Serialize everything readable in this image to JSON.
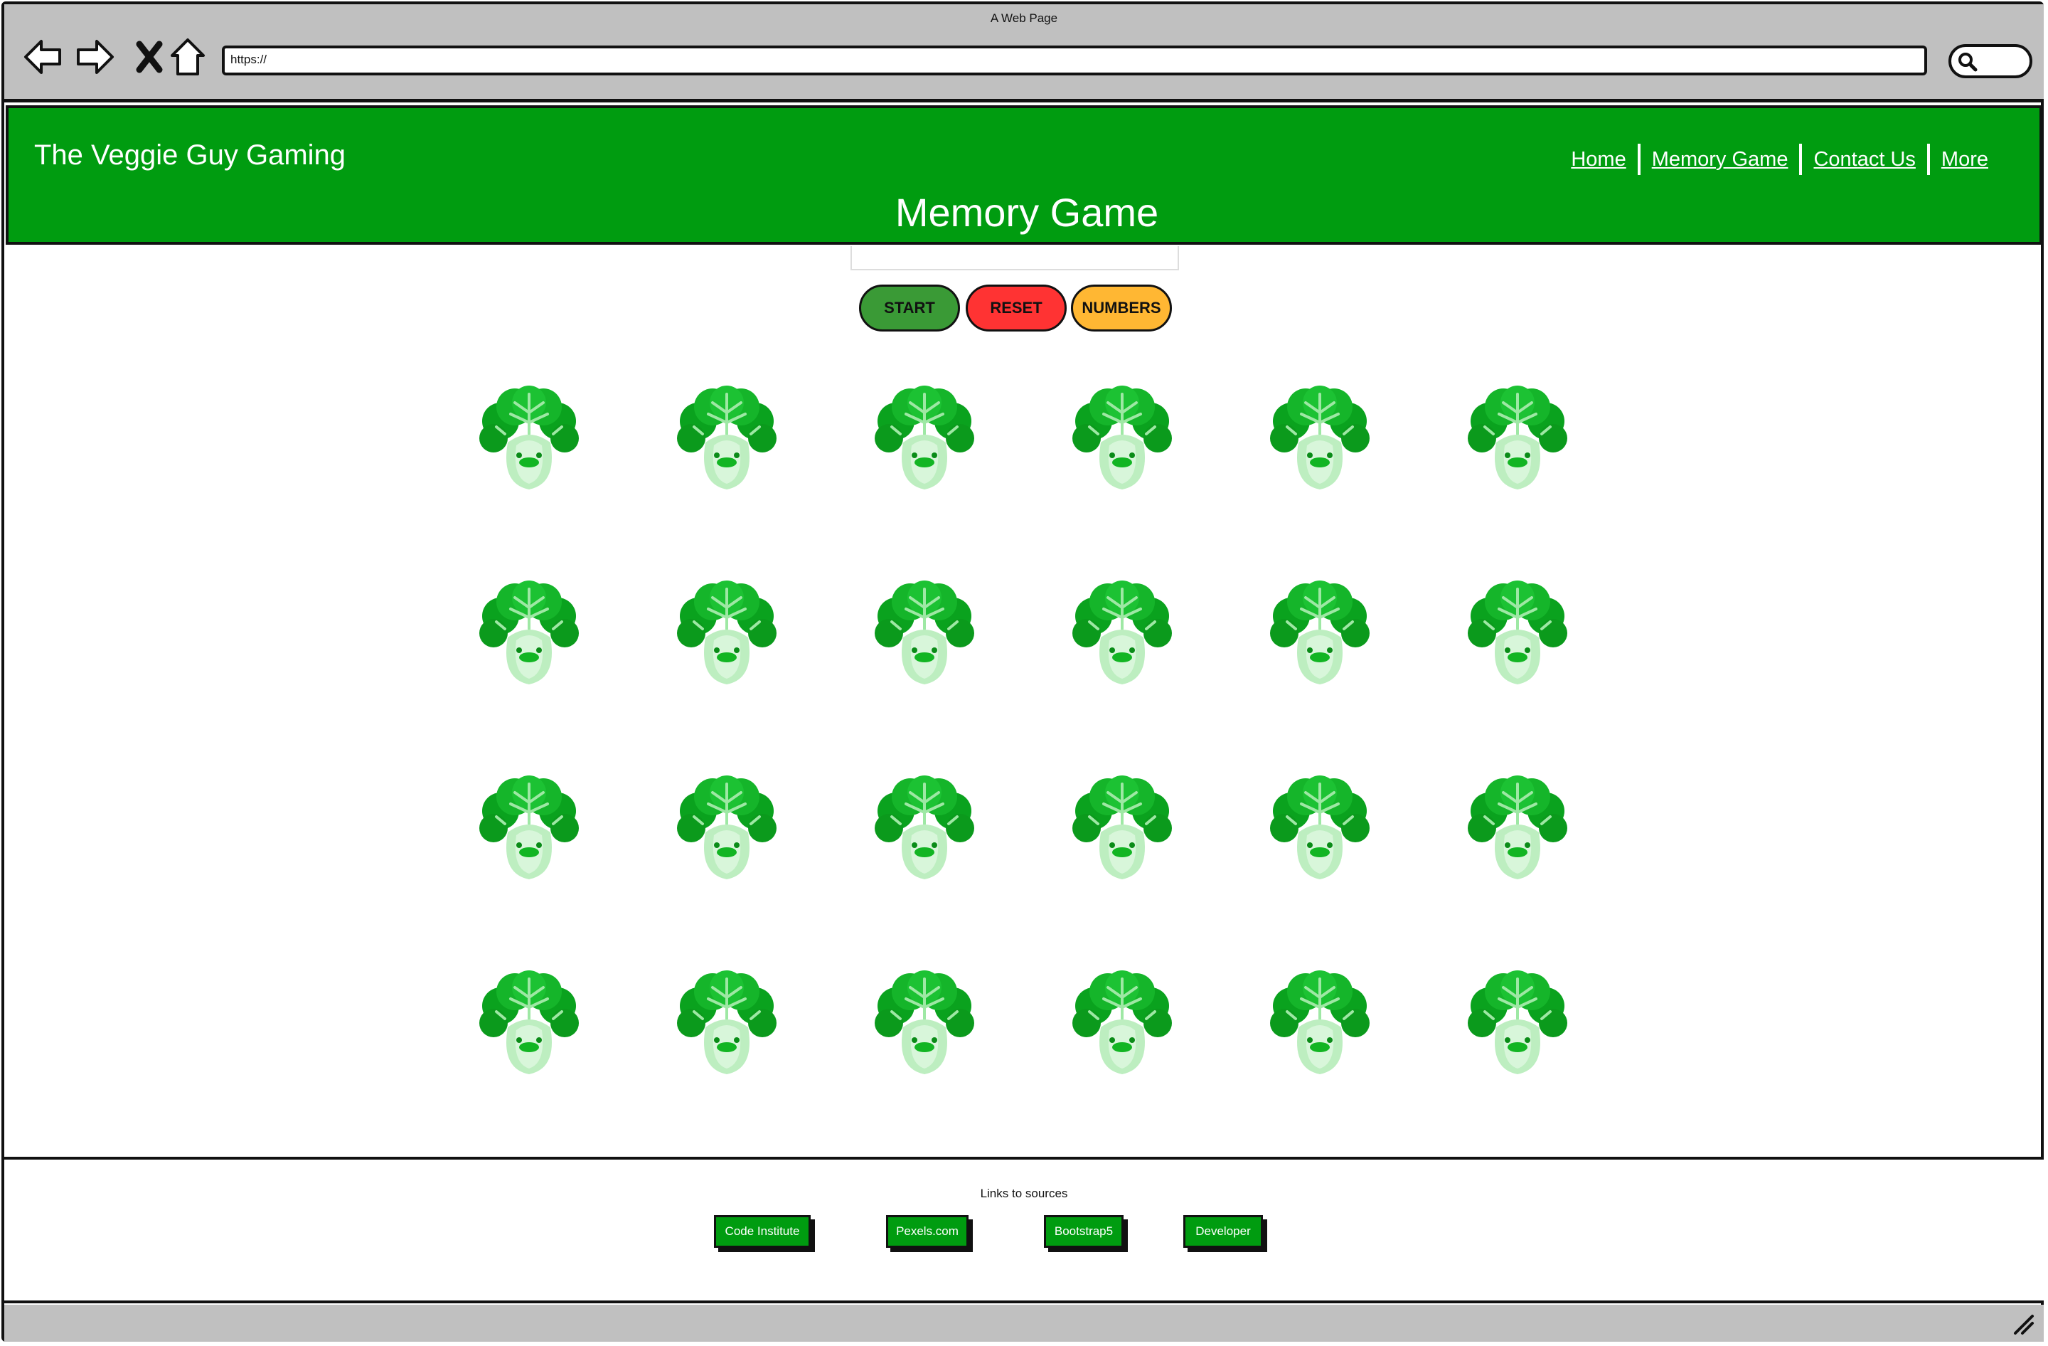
{
  "browser": {
    "window_title": "A Web Page",
    "url": "https://"
  },
  "header": {
    "brand": "The Veggie Guy Gaming",
    "nav": [
      "Home",
      "Memory Game",
      "Contact Us",
      "More"
    ],
    "page_title": "Memory Game"
  },
  "controls": {
    "start": "START",
    "reset": "RESET",
    "numbers": "NUMBERS",
    "colors": {
      "start": "#3a9a36",
      "reset": "#ff3333",
      "numbers": "#ffb733"
    }
  },
  "game": {
    "rows": 4,
    "cols": 6,
    "card_icon": "bok-choy-veggie-face-icon"
  },
  "footer": {
    "title": "Links to sources",
    "links": [
      "Code Institute",
      "Pexels.com",
      "Bootstrap5",
      "Developer"
    ]
  },
  "colors": {
    "brand_green": "#009c10",
    "chrome_gray": "#c0c0c0"
  }
}
